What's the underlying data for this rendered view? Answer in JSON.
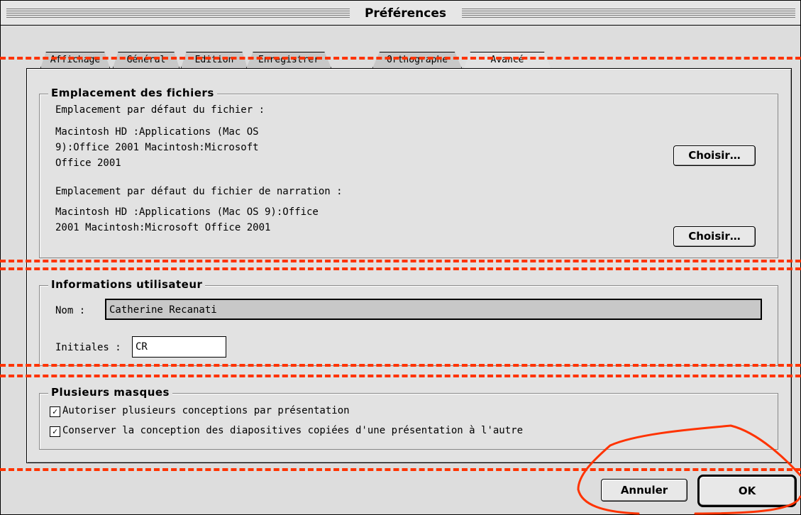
{
  "window": {
    "title": "Préférences"
  },
  "tabs": [
    {
      "label": "Affichage"
    },
    {
      "label": "Général"
    },
    {
      "label": "Edition"
    },
    {
      "label": "Enregistrer"
    },
    {
      "label": "Orthographe"
    },
    {
      "label": "Avancé",
      "active": true
    }
  ],
  "file_locations": {
    "title": "Emplacement des fichiers",
    "default_label": "Emplacement par défaut du fichier  :",
    "default_path_lines": [
      "Macintosh HD :Applications (Mac OS",
      "9):Office 2001 Macintosh:Microsoft",
      "Office 2001"
    ],
    "narration_label": "Emplacement par défaut du fichier de narration  :",
    "narration_path_lines": [
      "Macintosh HD :Applications (Mac OS 9):Office",
      "2001 Macintosh:Microsoft Office 2001"
    ],
    "choose_label": "Choisir…"
  },
  "user_info": {
    "title": "Informations utilisateur",
    "name_label": "Nom  :",
    "name_value": "Catherine Recanati",
    "initials_label": "Initiales  :",
    "initials_value": "CR"
  },
  "masters": {
    "title": "Plusieurs masques",
    "options": [
      {
        "label": "Autoriser plusieurs conceptions par présentation",
        "checked": true
      },
      {
        "label": "Conserver la conception des diapositives copiées d'une présentation à l'autre",
        "checked": true
      }
    ]
  },
  "buttons": {
    "cancel": "Annuler",
    "ok": "OK"
  },
  "annotation_color": "#ff3300"
}
